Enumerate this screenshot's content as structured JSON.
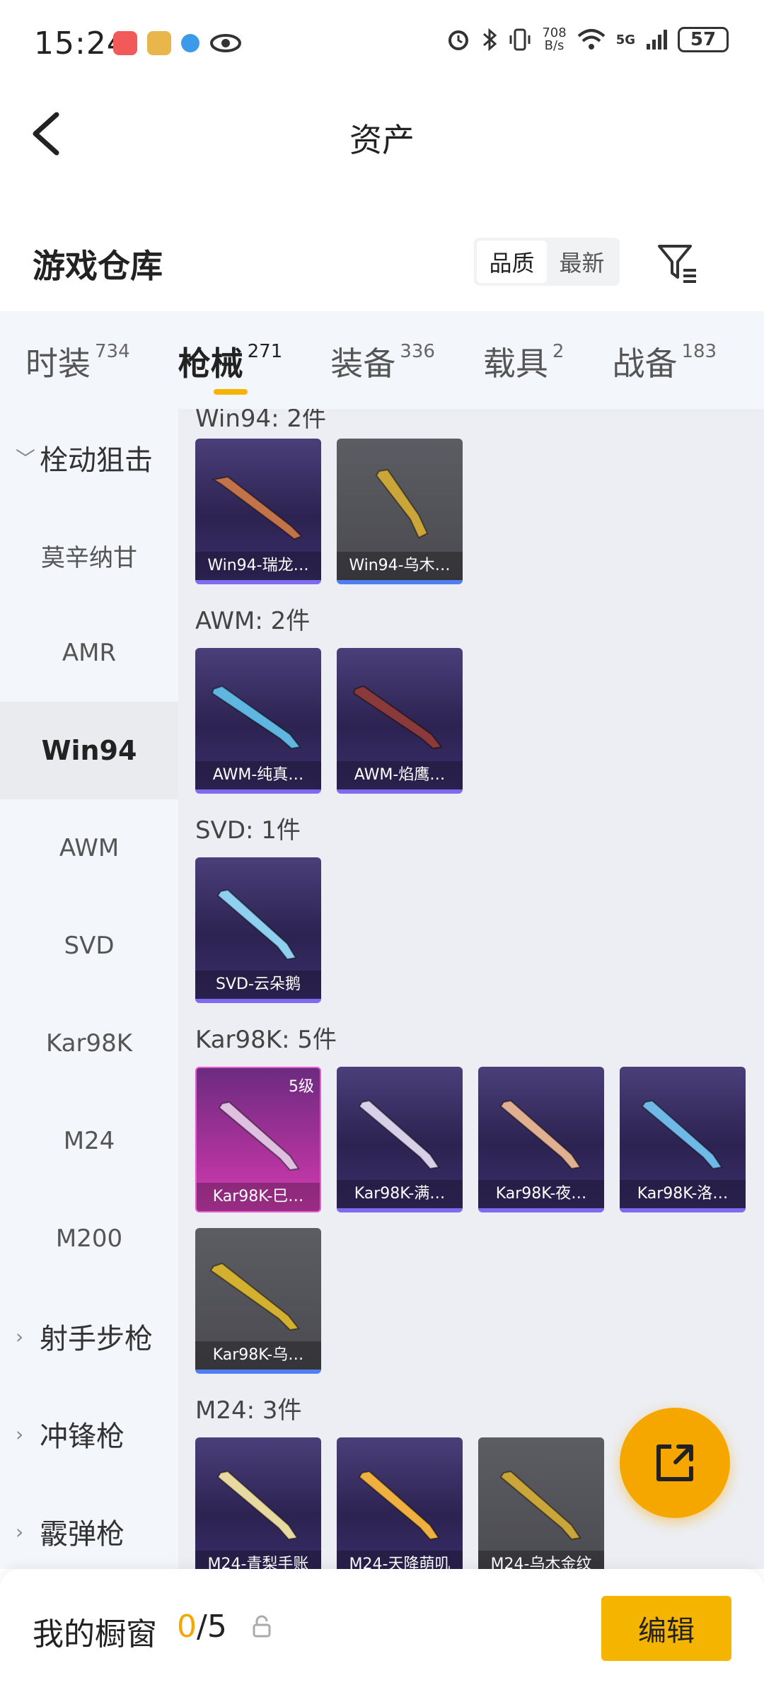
{
  "status_bar": {
    "time": "15:24",
    "net_speed_value": "708",
    "net_speed_unit": "B/s",
    "signal": "5G",
    "battery": "57"
  },
  "header": {
    "title": "资产"
  },
  "warehouse": {
    "title": "游戏仓库",
    "sort_options": [
      "品质",
      "最新"
    ],
    "active_sort": "品质"
  },
  "category_tabs": [
    {
      "label": "时装",
      "count": "734"
    },
    {
      "label": "枪械",
      "count": "271",
      "active": true
    },
    {
      "label": "装备",
      "count": "336"
    },
    {
      "label": "载具",
      "count": "2"
    },
    {
      "label": "战备",
      "count": "183"
    }
  ],
  "sidebar": [
    {
      "label": "栓动狙击",
      "type": "group-expanded"
    },
    {
      "label": "莫辛纳甘"
    },
    {
      "label": "AMR"
    },
    {
      "label": "Win94",
      "active": true
    },
    {
      "label": "AWM"
    },
    {
      "label": "SVD"
    },
    {
      "label": "Kar98K"
    },
    {
      "label": "M24"
    },
    {
      "label": "M200"
    },
    {
      "label": "射手步枪",
      "type": "group-collapsed"
    },
    {
      "label": "冲锋枪",
      "type": "group-collapsed"
    },
    {
      "label": "霰弹枪",
      "type": "group-collapsed"
    }
  ],
  "sections": [
    {
      "title": "Win94: 2件",
      "items": [
        {
          "label": "Win94-瑞龙…",
          "style": "purple",
          "gun_color": "#c2734a"
        },
        {
          "label": "Win94-乌木…",
          "style": "gray",
          "gun_color": "#c9a53a"
        }
      ]
    },
    {
      "title": "AWM: 2件",
      "items": [
        {
          "label": "AWM-纯真…",
          "style": "purple",
          "gun_color": "#5fb6e0"
        },
        {
          "label": "AWM-焰鹰…",
          "style": "purple",
          "gun_color": "#8a3a3a"
        }
      ]
    },
    {
      "title": "SVD: 1件",
      "items": [
        {
          "label": "SVD-云朵鹅",
          "style": "purple",
          "gun_color": "#8fcff0"
        }
      ]
    },
    {
      "title": "Kar98K: 5件",
      "items": [
        {
          "label": "Kar98K-巳…",
          "style": "pink",
          "gun_color": "#e0c0e0",
          "level": "5级"
        },
        {
          "label": "Kar98K-满…",
          "style": "purple",
          "gun_color": "#d8d0e8"
        },
        {
          "label": "Kar98K-夜…",
          "style": "purple",
          "gun_color": "#e0b090"
        },
        {
          "label": "Kar98K-洛…",
          "style": "purple",
          "gun_color": "#6fb8e8"
        },
        {
          "label": "Kar98K-乌…",
          "style": "gray",
          "gun_color": "#d4b030"
        }
      ]
    },
    {
      "title": "M24: 3件",
      "items": [
        {
          "label": "M24-青梨手账",
          "style": "purple",
          "gun_color": "#e8d9a0"
        },
        {
          "label": "M24-天降萌叽",
          "style": "purple",
          "gun_color": "#f0b040"
        },
        {
          "label": "M24-乌木金纹",
          "style": "gray",
          "gun_color": "#c9a53a"
        }
      ]
    }
  ],
  "bottom_bar": {
    "title": "我的橱窗",
    "used": "0",
    "total": "/5",
    "edit_label": "编辑"
  },
  "colors": {
    "accent": "#f5b400",
    "fab": "#f5a700"
  }
}
